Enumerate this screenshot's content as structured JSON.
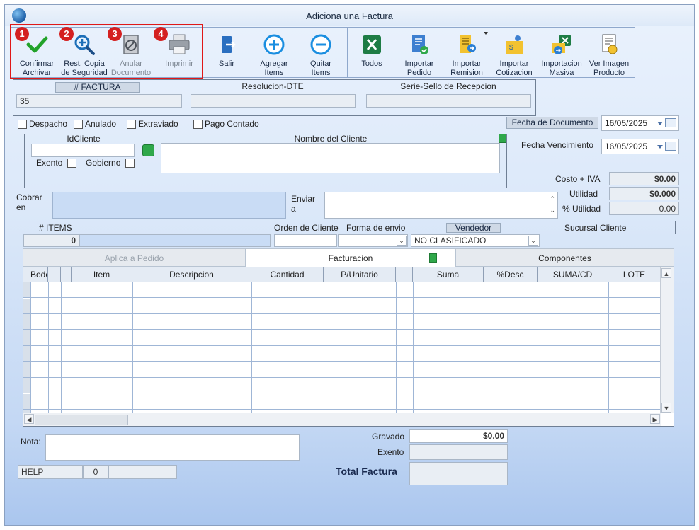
{
  "window": {
    "title": "Adiciona una Factura"
  },
  "toolbar": {
    "group1": [
      {
        "label": "Confirmar\nArchivar",
        "badge": "1",
        "icon": "check-icon"
      },
      {
        "label": "Rest. Copia\nde Seguridad",
        "badge": "2",
        "icon": "magnifier-plus-icon"
      },
      {
        "label": "Anular\nDocumento",
        "badge": "3",
        "icon": "void-document-icon",
        "disabled": true
      },
      {
        "label": "Imprimir",
        "badge": "4",
        "icon": "printer-icon",
        "disabled": true
      }
    ],
    "salir": "Salir",
    "agregar": "Agregar\nItems",
    "quitar": "Quitar\nItems",
    "todos": "Todos",
    "importar_pedido": "Importar\nPedido",
    "importar_remision": "Importar\nRemision",
    "importar_cotizacion": "Importar\nCotizacion",
    "importacion_masiva": "Importacion\nMasiva",
    "ver_imagen": "Ver Imagen\nProducto"
  },
  "header": {
    "factura_label": "# FACTURA",
    "factura_value": "35",
    "resolucion_label": "Resolucion-DTE",
    "resolucion_value": "",
    "serie_label": "Serie-Sello de Recepcion",
    "serie_value": ""
  },
  "flags": {
    "despacho": "Despacho",
    "anulado": "Anulado",
    "extraviado": "Extraviado",
    "pago_contado": "Pago Contado"
  },
  "dates": {
    "fecha_documento_label": "Fecha de  Documento",
    "fecha_documento": "16/05/2025",
    "fecha_vencimiento_label": "Fecha Vencimiento",
    "fecha_vencimiento": "16/05/2025"
  },
  "cliente": {
    "id_label": "IdCliente",
    "id_value": "",
    "nombre_label": "Nombre del Cliente",
    "nombre_value": "",
    "exento_label": "Exento",
    "gobierno_label": "Gobierno"
  },
  "costos": {
    "costo_iva_label": "Costo + IVA",
    "costo_iva": "$0.00",
    "utilidad_label": "Utilidad",
    "utilidad": "$0.000",
    "pct_utilidad_label": "% Utilidad",
    "pct_utilidad": "0.00"
  },
  "envio": {
    "cobrar_label": "Cobrar\nen",
    "enviar_label": "Enviar\na"
  },
  "items_bar": {
    "items_label": "# ITEMS",
    "items_value": "0",
    "orden_label": "Orden de Cliente",
    "forma_label": "Forma de envio",
    "vendedor_label": "Vendedor",
    "vendedor_value": "NO CLASIFICADO",
    "sucursal_label": "Sucursal Cliente"
  },
  "tabs": [
    "Aplica a Pedido",
    "Facturacion",
    "Componentes"
  ],
  "grid": {
    "columns": [
      "Bodega",
      "Item",
      "Descripcion",
      "Cantidad",
      "P/Unitario",
      "Suma",
      "%Desc",
      "SUMA/CD",
      "LOTE"
    ],
    "rows": 9
  },
  "footer": {
    "nota_label": "Nota:",
    "nota_value": "",
    "help_label": "HELP",
    "help_value": "0",
    "gravado_label": "Gravado",
    "gravado_value": "$0.00",
    "exento_label": "Exento",
    "exento_value": "",
    "total_label": "Total Factura",
    "total_value": ""
  },
  "colors": {
    "accent": "#1d5fa8",
    "badge": "#d42020",
    "check": "#22a22a"
  }
}
